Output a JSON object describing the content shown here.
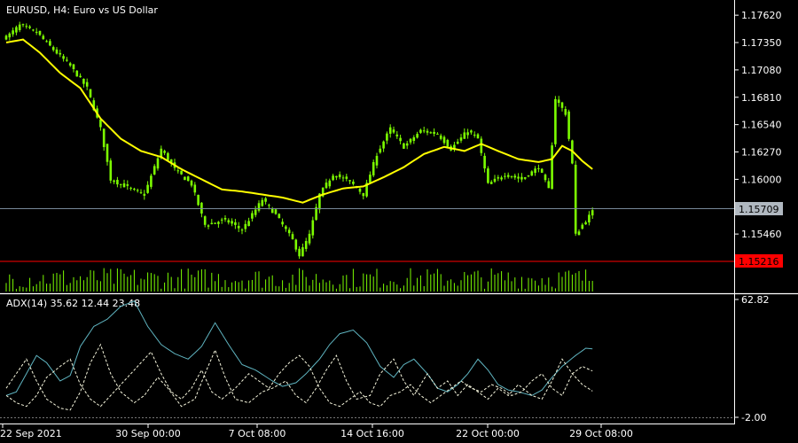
{
  "window": {
    "symbol_title": "EURUSD, H4:  Euro vs US Dollar"
  },
  "colors": {
    "background": "#000000",
    "candle": "#7CFC00",
    "moving_average": "#FFFF00",
    "bid_line": "#778899",
    "bid_label_bg": "#B0B8C0",
    "level_line": "#FF0000",
    "adx_line": "#5FB4C0",
    "di_lines": "#F5F5DC",
    "axis": "#FFFFFF"
  },
  "chart_data": [
    {
      "type": "candlestick",
      "title": "EURUSD, H4:  Euro vs US Dollar",
      "price_ticks": [
        "1.17620",
        "1.17350",
        "1.17080",
        "1.16810",
        "1.16540",
        "1.16270",
        "1.16000",
        "1.15460"
      ],
      "current_price_label": "1.15709",
      "level_label": "1.15216",
      "ylim": [
        1.1519,
        1.177
      ],
      "x_ticks": [
        "22 Sep 2021",
        "30 Sep 00:00",
        "7 Oct 08:00",
        "14 Oct 16:00",
        "22 Oct 00:00",
        "29 Oct 08:00"
      ],
      "close_anchors": [
        [
          0,
          1.174
        ],
        [
          4,
          1.1752
        ],
        [
          9,
          1.1745
        ],
        [
          14,
          1.1728
        ],
        [
          19,
          1.1712
        ],
        [
          24,
          1.169
        ],
        [
          28,
          1.165
        ],
        [
          31,
          1.16
        ],
        [
          36,
          1.1592
        ],
        [
          41,
          1.1585
        ],
        [
          46,
          1.163
        ],
        [
          50,
          1.161
        ],
        [
          55,
          1.1595
        ],
        [
          59,
          1.1555
        ],
        [
          65,
          1.156
        ],
        [
          70,
          1.155
        ],
        [
          76,
          1.158
        ],
        [
          80,
          1.1565
        ],
        [
          85,
          1.154
        ],
        [
          87,
          1.1525
        ],
        [
          90,
          1.1545
        ],
        [
          93,
          1.1585
        ],
        [
          97,
          1.1605
        ],
        [
          102,
          1.1598
        ],
        [
          106,
          1.1585
        ],
        [
          110,
          1.1625
        ],
        [
          114,
          1.165
        ],
        [
          118,
          1.1632
        ],
        [
          123,
          1.1648
        ],
        [
          128,
          1.1645
        ],
        [
          132,
          1.163
        ],
        [
          137,
          1.1648
        ],
        [
          140,
          1.164
        ],
        [
          143,
          1.1595
        ],
        [
          148,
          1.1605
        ],
        [
          153,
          1.16
        ],
        [
          158,
          1.1612
        ],
        [
          161,
          1.159
        ],
        [
          163,
          1.168
        ],
        [
          166,
          1.1665
        ],
        [
          168,
          1.1615
        ],
        [
          169,
          1.1545
        ],
        [
          171,
          1.1555
        ],
        [
          174,
          1.1568
        ]
      ],
      "ma_anchors": [
        [
          0,
          1.1735
        ],
        [
          5,
          1.1738
        ],
        [
          10,
          1.1725
        ],
        [
          16,
          1.1705
        ],
        [
          22,
          1.169
        ],
        [
          28,
          1.166
        ],
        [
          34,
          1.164
        ],
        [
          40,
          1.1628
        ],
        [
          46,
          1.1622
        ],
        [
          52,
          1.161
        ],
        [
          58,
          1.16
        ],
        [
          64,
          1.159
        ],
        [
          70,
          1.1588
        ],
        [
          76,
          1.1585
        ],
        [
          82,
          1.1582
        ],
        [
          88,
          1.1577
        ],
        [
          94,
          1.1585
        ],
        [
          100,
          1.1591
        ],
        [
          106,
          1.1593
        ],
        [
          112,
          1.1602
        ],
        [
          118,
          1.1612
        ],
        [
          124,
          1.1625
        ],
        [
          130,
          1.1632
        ],
        [
          136,
          1.1628
        ],
        [
          141,
          1.1635
        ],
        [
          146,
          1.1628
        ],
        [
          152,
          1.162
        ],
        [
          158,
          1.1617
        ],
        [
          162,
          1.162
        ],
        [
          165,
          1.1633
        ],
        [
          168,
          1.1628
        ],
        [
          171,
          1.1618
        ],
        [
          174,
          1.161
        ]
      ],
      "volume_bars": "tick volume histogram"
    },
    {
      "type": "line",
      "title": "ADX(14) 35.62 12.44 23.48",
      "y_ticks": [
        "62.82",
        "-2.00"
      ],
      "ylim": [
        -2.0,
        62.82
      ],
      "series": [
        {
          "key": "adx",
          "style": "solid",
          "anchors": [
            [
              0,
              10
            ],
            [
              3,
              12
            ],
            [
              6,
              22
            ],
            [
              9,
              32
            ],
            [
              12,
              28
            ],
            [
              16,
              18
            ],
            [
              19,
              21
            ],
            [
              22,
              37
            ],
            [
              26,
              48
            ],
            [
              30,
              52
            ],
            [
              34,
              59
            ],
            [
              38,
              62
            ],
            [
              42,
              48
            ],
            [
              46,
              38
            ],
            [
              50,
              33
            ],
            [
              54,
              30
            ],
            [
              58,
              37
            ],
            [
              62,
              50
            ],
            [
              66,
              38
            ],
            [
              70,
              27
            ],
            [
              74,
              24
            ],
            [
              79,
              18
            ],
            [
              82,
              15
            ],
            [
              86,
              17
            ],
            [
              89,
              22
            ],
            [
              93,
              30
            ],
            [
              96,
              38
            ],
            [
              99,
              44
            ],
            [
              103,
              46
            ],
            [
              107,
              39
            ],
            [
              111,
              26
            ],
            [
              115,
              20
            ],
            [
              118,
              27
            ],
            [
              121,
              30
            ],
            [
              125,
              22
            ],
            [
              128,
              14
            ],
            [
              131,
              12
            ],
            [
              134,
              16
            ],
            [
              137,
              22
            ],
            [
              140,
              30
            ],
            [
              143,
              24
            ],
            [
              146,
              16
            ],
            [
              149,
              13
            ],
            [
              152,
              12
            ],
            [
              156,
              10
            ],
            [
              159,
              13
            ],
            [
              162,
              20
            ],
            [
              165,
              26
            ],
            [
              169,
              32
            ],
            [
              172,
              36
            ],
            [
              174,
              35.62
            ]
          ]
        },
        {
          "key": "plus_di",
          "style": "dashed",
          "anchors": [
            [
              0,
              14
            ],
            [
              3,
              22
            ],
            [
              6,
              30
            ],
            [
              9,
              18
            ],
            [
              12,
              8
            ],
            [
              16,
              3
            ],
            [
              19,
              2
            ],
            [
              22,
              12
            ],
            [
              25,
              28
            ],
            [
              28,
              38
            ],
            [
              31,
              22
            ],
            [
              34,
              12
            ],
            [
              38,
              6
            ],
            [
              41,
              10
            ],
            [
              45,
              20
            ],
            [
              48,
              14
            ],
            [
              52,
              4
            ],
            [
              56,
              8
            ],
            [
              59,
              22
            ],
            [
              62,
              35
            ],
            [
              65,
              20
            ],
            [
              68,
              8
            ],
            [
              72,
              6
            ],
            [
              76,
              12
            ],
            [
              79,
              14
            ],
            [
              83,
              18
            ],
            [
              86,
              10
            ],
            [
              89,
              6
            ],
            [
              92,
              14
            ],
            [
              95,
              24
            ],
            [
              98,
              32
            ],
            [
              101,
              18
            ],
            [
              104,
              8
            ],
            [
              108,
              10
            ],
            [
              111,
              22
            ],
            [
              115,
              30
            ],
            [
              118,
              18
            ],
            [
              121,
              10
            ],
            [
              125,
              22
            ],
            [
              128,
              14
            ],
            [
              131,
              18
            ],
            [
              134,
              10
            ],
            [
              137,
              16
            ],
            [
              140,
              12
            ],
            [
              143,
              8
            ],
            [
              146,
              14
            ],
            [
              149,
              10
            ],
            [
              152,
              16
            ],
            [
              156,
              10
            ],
            [
              159,
              8
            ],
            [
              162,
              18
            ],
            [
              165,
              30
            ],
            [
              168,
              22
            ],
            [
              171,
              16
            ],
            [
              174,
              12.44
            ]
          ]
        },
        {
          "key": "minus_di",
          "style": "dashed",
          "anchors": [
            [
              0,
              10
            ],
            [
              3,
              6
            ],
            [
              6,
              4
            ],
            [
              9,
              10
            ],
            [
              12,
              20
            ],
            [
              16,
              26
            ],
            [
              19,
              30
            ],
            [
              22,
              16
            ],
            [
              25,
              8
            ],
            [
              28,
              4
            ],
            [
              31,
              10
            ],
            [
              34,
              16
            ],
            [
              37,
              22
            ],
            [
              40,
              28
            ],
            [
              43,
              34
            ],
            [
              46,
              22
            ],
            [
              49,
              12
            ],
            [
              52,
              8
            ],
            [
              55,
              14
            ],
            [
              58,
              24
            ],
            [
              61,
              12
            ],
            [
              64,
              8
            ],
            [
              68,
              14
            ],
            [
              72,
              22
            ],
            [
              75,
              18
            ],
            [
              78,
              14
            ],
            [
              81,
              22
            ],
            [
              84,
              28
            ],
            [
              87,
              32
            ],
            [
              90,
              26
            ],
            [
              93,
              14
            ],
            [
              96,
              6
            ],
            [
              99,
              4
            ],
            [
              102,
              8
            ],
            [
              105,
              12
            ],
            [
              108,
              6
            ],
            [
              111,
              4
            ],
            [
              114,
              10
            ],
            [
              117,
              12
            ],
            [
              120,
              16
            ],
            [
              123,
              10
            ],
            [
              126,
              6
            ],
            [
              129,
              10
            ],
            [
              132,
              14
            ],
            [
              135,
              18
            ],
            [
              138,
              14
            ],
            [
              141,
              12
            ],
            [
              144,
              16
            ],
            [
              147,
              14
            ],
            [
              150,
              10
            ],
            [
              153,
              12
            ],
            [
              156,
              18
            ],
            [
              159,
              22
            ],
            [
              162,
              14
            ],
            [
              165,
              10
            ],
            [
              168,
              22
            ],
            [
              171,
              26
            ],
            [
              174,
              23.48
            ]
          ]
        }
      ]
    }
  ]
}
